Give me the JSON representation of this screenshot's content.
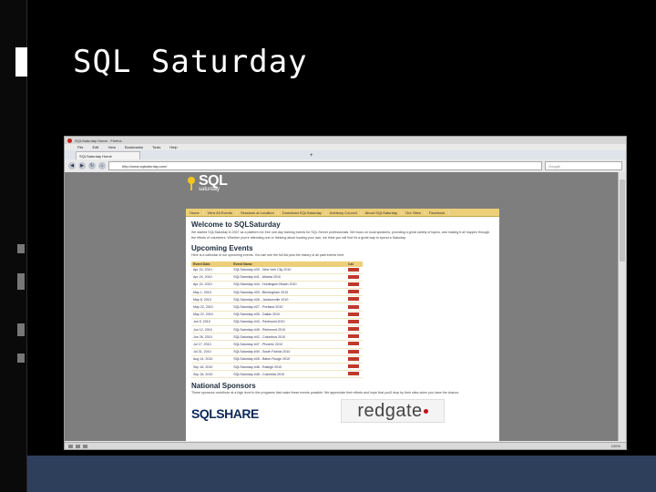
{
  "slide": {
    "title": "SQL Saturday"
  },
  "browser": {
    "window_title": "SQLSaturday Home - Firefox",
    "menu": [
      "File",
      "Edit",
      "View",
      "Bookmarks",
      "Tools",
      "Help"
    ],
    "tab_label": "SQLSaturday Home",
    "tab_add": "+",
    "url": "http://www.sqlsaturday.com/",
    "search_placeholder": "Google",
    "status_zoom": "100%"
  },
  "site": {
    "logo_main": "SQL",
    "logo_sub": "saturday",
    "nav": [
      "Home",
      "View All Events",
      "Sessions at Location",
      "Download SQLSaturday",
      "Advisory Council",
      "About SQLSaturday",
      "Our Sites",
      "Facebook"
    ],
    "welcome_heading": "Welcome to SQLSaturday",
    "welcome_text": "We started SQLSaturday in 2007 as a platform for free one-day training events for SQL Server professionals. We focus on local speakers, providing a great variety of topics, and making it all happen through the efforts of volunteers. Whether you're attending one or thinking about hosting your own, we think you will find it's a great way to spend a Saturday.",
    "upcoming_heading": "Upcoming Events",
    "upcoming_text": "Here is a calendar of our upcoming events. You can see the full list plus the history of all past events here.",
    "events_columns": [
      "Event Date",
      "Event Name",
      "Cal"
    ],
    "events": [
      {
        "date": "Apr 24, 2010",
        "name": "SQLSaturday #39 - New York City 2010"
      },
      {
        "date": "Apr 24, 2010",
        "name": "SQLSaturday #41 - Atlanta 2010"
      },
      {
        "date": "Apr 24, 2010",
        "name": "SQLSaturday #44 - Huntington Beach 2010"
      },
      {
        "date": "May 1, 2010",
        "name": "SQLSaturday #29 - Birmingham 2010"
      },
      {
        "date": "May 8, 2010",
        "name": "SQLSaturday #38 - Jacksonville 2010"
      },
      {
        "date": "May 22, 2010",
        "name": "SQLSaturday #27 - Portland 2010"
      },
      {
        "date": "May 22, 2010",
        "name": "SQLSaturday #35 - Dallas 2010"
      },
      {
        "date": "Jun 5, 2010",
        "name": "SQLSaturday #43 - Redmond 2010"
      },
      {
        "date": "Jun 12, 2010",
        "name": "SQLSaturday #45 - Richmond 2010"
      },
      {
        "date": "Jun 26, 2010",
        "name": "SQLSaturday #42 - Columbus 2010"
      },
      {
        "date": "Jul 17, 2010",
        "name": "SQLSaturday #47 - Phoenix 2010"
      },
      {
        "date": "Jul 31, 2010",
        "name": "SQLSaturday #40 - South Florida 2010"
      },
      {
        "date": "Aug 14, 2010",
        "name": "SQLSaturday #28 - Baton Rouge 2010"
      },
      {
        "date": "Sep 18, 2010",
        "name": "SQLSaturday #46 - Raleigh 2010"
      },
      {
        "date": "Sep 18, 2010",
        "name": "SQLSaturday #48 - Columbia 2010"
      }
    ],
    "sponsors_heading": "National Sponsors",
    "sponsors_text": "These sponsors contribute at a high level to the programs that make these events possible. We appreciate their efforts and hope that you'll drop by their sites when you have the chance.",
    "sponsor_1": "SQLSHARE",
    "sponsor_2": "redgate"
  },
  "colors": {
    "slide_bg": "#000000",
    "slide_bottom_band": "#2e3f5c",
    "site_nav": "#edcf79",
    "logo_key": "#f3c619",
    "redgate_dot": "#c20f1a"
  }
}
